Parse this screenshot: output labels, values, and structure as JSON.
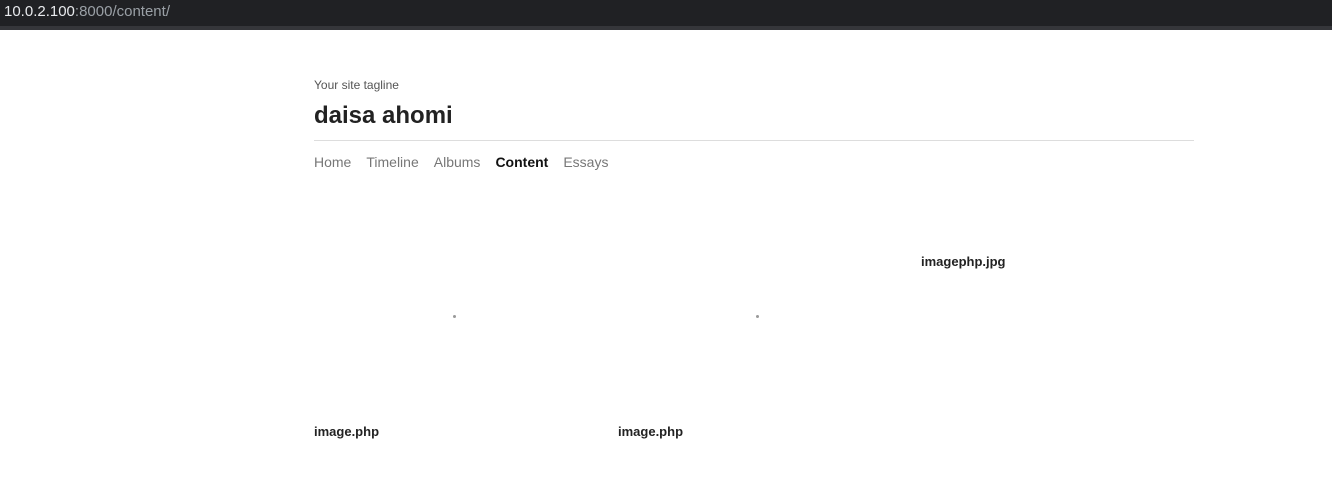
{
  "browser": {
    "url_host": "10.0.2.100",
    "url_rest": ":8000/content/"
  },
  "site": {
    "tagline": "Your site tagline",
    "title": "daisa ahomi"
  },
  "nav": {
    "items": [
      {
        "label": "Home"
      },
      {
        "label": "Timeline"
      },
      {
        "label": "Albums"
      },
      {
        "label": "Content"
      },
      {
        "label": "Essays"
      }
    ],
    "active": "Content"
  },
  "content": {
    "items": [
      {
        "caption": "image.php"
      },
      {
        "caption": "image.php"
      },
      {
        "caption": "imagephp.jpg"
      }
    ]
  }
}
